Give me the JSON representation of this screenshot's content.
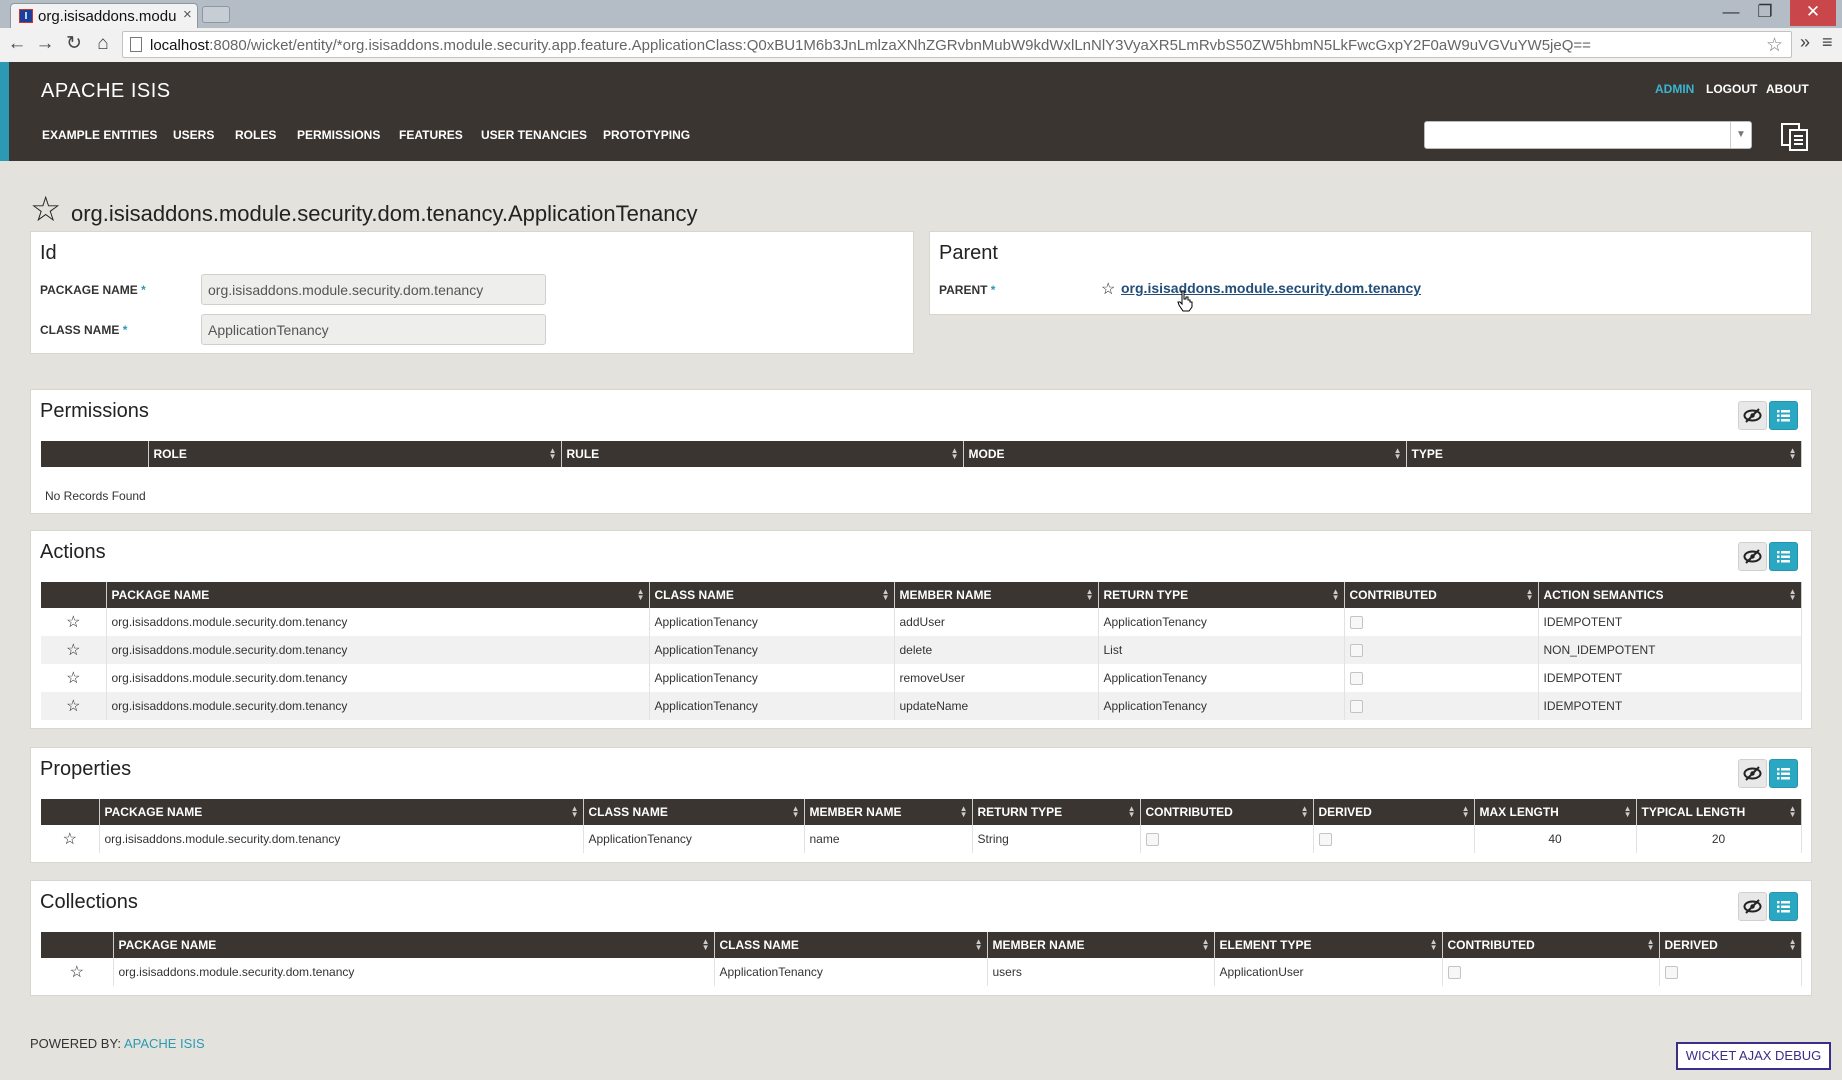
{
  "browser": {
    "tab_title": "org.isisaddons.modu",
    "tab_close": "×",
    "url_host": "localhost",
    "url_path": ":8080/wicket/entity/*org.isisaddons.module.security.app.feature.ApplicationClass:Q0xBU1M6b3JnLmlzaXNhZGRvbnMubW9kdWxlLnNlY3VyaXR5LmRvbS50ZW5hbmN5LkFwcGxpY2F0aW9uVGVuYW5jeQ==",
    "window_controls": [
      "—",
      "❐",
      "✕"
    ]
  },
  "app": {
    "brand": "APACHE ISIS",
    "top_nav": [
      "ADMIN",
      "LOGOUT",
      "ABOUT"
    ],
    "main_nav": [
      "EXAMPLE ENTITIES",
      "USERS",
      "ROLES",
      "PERMISSIONS",
      "FEATURES",
      "USER TENANCIES",
      "PROTOTYPING"
    ],
    "search_value": ""
  },
  "entity": {
    "title": "org.isisaddons.module.security.dom.tenancy.ApplicationTenancy"
  },
  "id_panel": {
    "heading": "Id",
    "package_label": "PACKAGE NAME",
    "package_value": "org.isisaddons.module.security.dom.tenancy",
    "class_label": "CLASS NAME",
    "class_value": "ApplicationTenancy",
    "required_mark": "*"
  },
  "parent_panel": {
    "heading": "Parent",
    "label": "PARENT",
    "value": "org.isisaddons.module.security.dom.tenancy"
  },
  "permissions": {
    "heading": "Permissions",
    "columns": [
      "ROLE",
      "RULE",
      "MODE",
      "TYPE"
    ],
    "empty_text": "No Records Found"
  },
  "actions": {
    "heading": "Actions",
    "columns": [
      "PACKAGE NAME",
      "CLASS NAME",
      "MEMBER NAME",
      "RETURN TYPE",
      "CONTRIBUTED",
      "ACTION SEMANTICS"
    ],
    "rows": [
      [
        "org.isisaddons.module.security.dom.tenancy",
        "ApplicationTenancy",
        "addUser",
        "ApplicationTenancy",
        "",
        "IDEMPOTENT"
      ],
      [
        "org.isisaddons.module.security.dom.tenancy",
        "ApplicationTenancy",
        "delete",
        "List",
        "",
        "NON_IDEMPOTENT"
      ],
      [
        "org.isisaddons.module.security.dom.tenancy",
        "ApplicationTenancy",
        "removeUser",
        "ApplicationTenancy",
        "",
        "IDEMPOTENT"
      ],
      [
        "org.isisaddons.module.security.dom.tenancy",
        "ApplicationTenancy",
        "updateName",
        "ApplicationTenancy",
        "",
        "IDEMPOTENT"
      ]
    ]
  },
  "properties": {
    "heading": "Properties",
    "columns": [
      "PACKAGE NAME",
      "CLASS NAME",
      "MEMBER NAME",
      "RETURN TYPE",
      "CONTRIBUTED",
      "DERIVED",
      "MAX LENGTH",
      "TYPICAL LENGTH"
    ],
    "rows": [
      [
        "org.isisaddons.module.security.dom.tenancy",
        "ApplicationTenancy",
        "name",
        "String",
        "",
        "",
        "40",
        "20"
      ]
    ]
  },
  "collections": {
    "heading": "Collections",
    "columns": [
      "PACKAGE NAME",
      "CLASS NAME",
      "MEMBER NAME",
      "ELEMENT TYPE",
      "CONTRIBUTED",
      "DERIVED"
    ],
    "rows": [
      [
        "org.isisaddons.module.security.dom.tenancy",
        "ApplicationTenancy",
        "users",
        "ApplicationUser",
        "",
        ""
      ]
    ]
  },
  "footer": {
    "powered_by": "POWERED BY:",
    "link": "APACHE ISIS",
    "debug": "WICKET AJAX DEBUG"
  }
}
